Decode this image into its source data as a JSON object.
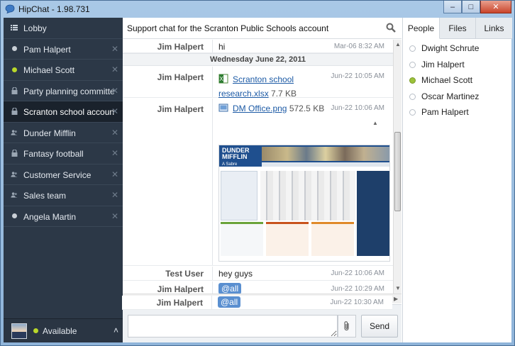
{
  "window": {
    "title": "HipChat - 1.98.731",
    "minimize": "–",
    "maximize": "□",
    "close": "✕"
  },
  "sidebar": {
    "rooms": [
      {
        "label": "Lobby",
        "icon": "list-icon",
        "closable": false,
        "active": false
      },
      {
        "label": "Pam Halpert",
        "icon": "presence-dot-gray",
        "closable": true,
        "active": false
      },
      {
        "label": "Michael Scott",
        "icon": "presence-dot-green",
        "closable": true,
        "active": false
      },
      {
        "label": "Party planning committee",
        "icon": "lock-icon",
        "closable": true,
        "active": false
      },
      {
        "label": "Scranton school account",
        "icon": "lock-icon",
        "closable": true,
        "active": true
      },
      {
        "label": "Dunder Mifflin",
        "icon": "group-icon",
        "closable": true,
        "active": false
      },
      {
        "label": "Fantasy football",
        "icon": "lock-icon",
        "closable": true,
        "active": false
      },
      {
        "label": "Customer Service",
        "icon": "group-icon",
        "closable": true,
        "active": false
      },
      {
        "label": "Sales team",
        "icon": "group-icon",
        "closable": true,
        "active": false
      },
      {
        "label": "Angela Martin",
        "icon": "presence-dot-gray",
        "closable": true,
        "active": false
      }
    ],
    "close_glyph": "✕",
    "footer": {
      "status": "Available",
      "chevron": "˄"
    }
  },
  "chat": {
    "topic": "Support chat for the Scranton Public Schools account",
    "date_divider": "Wednesday June 22, 2011",
    "messages": [
      {
        "from": "Jim Halpert",
        "text": "hi",
        "time": "Mar-06 8:32 AM"
      },
      {
        "from": "Jim Halpert",
        "file": "Scranton school research.xlsx",
        "file_line1": "Scranton school",
        "file_line2": "research.xlsx",
        "size": "7.7 KB",
        "time": "Jun-22 10:05 AM"
      },
      {
        "from": "Jim Halpert",
        "file": "DM Office.png",
        "size": "572.5 KB",
        "time": "Jun-22 10:06 AM"
      },
      {
        "from": "Test User",
        "text": "hey guys",
        "time": "Jun-22 10:06 AM"
      },
      {
        "from": "Jim Halpert",
        "mention": "@all",
        "time": "Jun-22 10:29 AM"
      },
      {
        "from": "Jim Halpert",
        "mention": "@all",
        "time": "Jun-22 10:30 AM"
      }
    ],
    "preview": {
      "logo_line1": "DUNDER",
      "logo_line2": "MIFFLIN",
      "logo_line3": "A Sabre"
    },
    "composer": {
      "value": "",
      "send_label": "Send"
    }
  },
  "right_panel": {
    "tabs": [
      {
        "label": "People",
        "active": true
      },
      {
        "label": "Files",
        "active": false
      },
      {
        "label": "Links",
        "active": false
      }
    ],
    "people": [
      {
        "name": "Dwight Schrute",
        "status": "offline"
      },
      {
        "name": "Jim Halpert",
        "status": "offline"
      },
      {
        "name": "Michael Scott",
        "status": "available"
      },
      {
        "name": "Oscar Martinez",
        "status": "offline"
      },
      {
        "name": "Pam Halpert",
        "status": "offline"
      }
    ]
  },
  "colors": {
    "sidebar_bg": "#2c3847",
    "active_room_bg": "#1a222c",
    "available_green": "#b9d82a",
    "link_blue": "#1c5aa5",
    "mention_blue": "#5a8fd0"
  }
}
